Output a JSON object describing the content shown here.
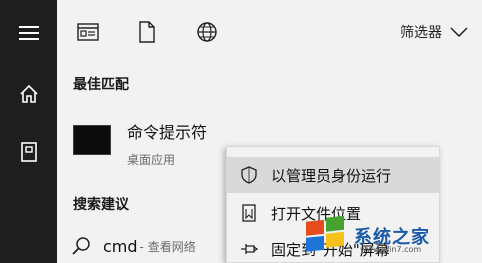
{
  "filter": {
    "label": "筛选器"
  },
  "best_match": {
    "title": "最佳匹配",
    "app_name": "命令提示符",
    "app_type": "桌面应用"
  },
  "suggestions": {
    "title": "搜索建议",
    "query": "cmd",
    "text": " - 查看网络"
  },
  "context_menu": {
    "items": [
      {
        "label": "以管理员身份运行",
        "icon": "shield-icon",
        "highlighted": true
      },
      {
        "label": "打开文件位置",
        "icon": "file-location-icon",
        "highlighted": false
      },
      {
        "label": "固定到\"开始\"屏幕",
        "icon": "pin-icon",
        "highlighted": false
      }
    ]
  },
  "watermark": {
    "text": "系统之家",
    "url": "www.Win7.com"
  }
}
